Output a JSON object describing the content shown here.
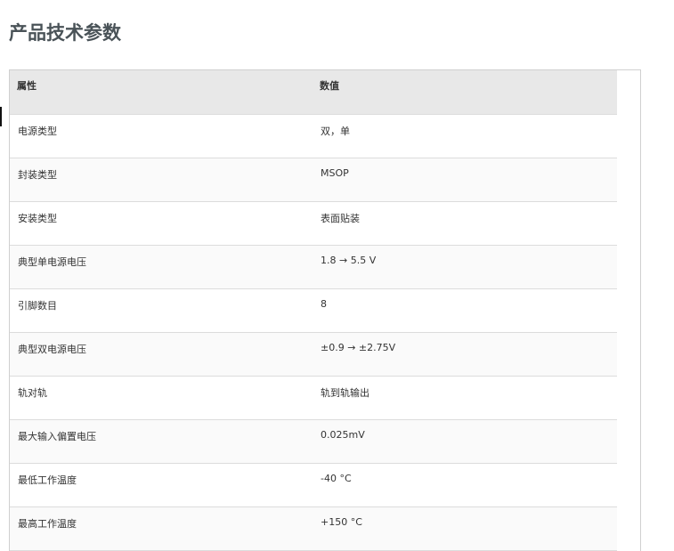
{
  "page": {
    "title": "产品技术参数"
  },
  "table": {
    "headers": [
      "属性",
      "数值"
    ],
    "rows": [
      {
        "attribute": "电源类型",
        "value": "双，单"
      },
      {
        "attribute": "封装类型",
        "value": "MSOP"
      },
      {
        "attribute": "安装类型",
        "value": "表面贴装"
      },
      {
        "attribute": "典型单电源电压",
        "value": "1.8 → 5.5 V"
      },
      {
        "attribute": "引脚数目",
        "value": "8"
      },
      {
        "attribute": "典型双电源电压",
        "value": "±0.9 → ±2.75V"
      },
      {
        "attribute": "轨对轨",
        "value": "轨到轨输出"
      },
      {
        "attribute": "最大输入偏置电压",
        "value": "0.025mV"
      },
      {
        "attribute": "最低工作温度",
        "value": "-40 °C"
      },
      {
        "attribute": "最高工作温度",
        "value": "+150 °C"
      }
    ]
  }
}
